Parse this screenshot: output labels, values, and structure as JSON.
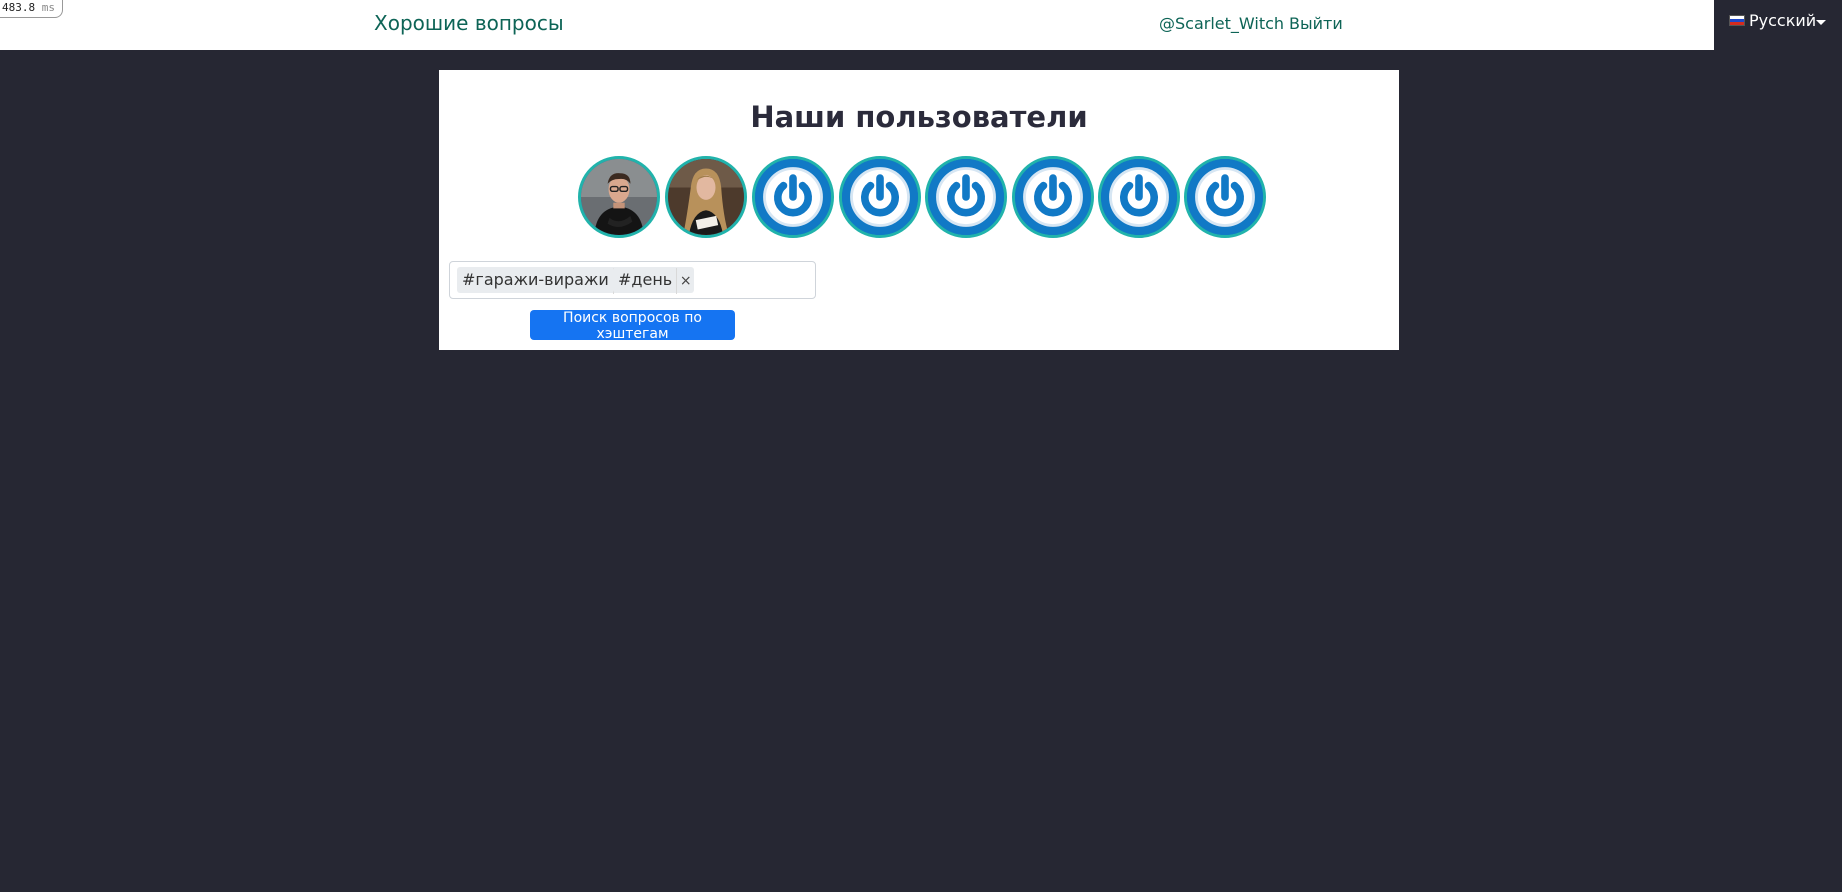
{
  "perf": {
    "value": "483.8",
    "unit": "ms"
  },
  "navbar": {
    "brand": "Хорошие вопросы",
    "user": "@Scarlet_Witch",
    "logout": "Выйти",
    "language": "Русский"
  },
  "main": {
    "title": "Наши пользователи",
    "avatars": [
      {
        "kind": "photo-man"
      },
      {
        "kind": "photo-woman"
      },
      {
        "kind": "default-power-icon"
      },
      {
        "kind": "default-power-icon"
      },
      {
        "kind": "default-power-icon"
      },
      {
        "kind": "default-power-icon"
      },
      {
        "kind": "default-power-icon"
      },
      {
        "kind": "default-power-icon"
      }
    ],
    "hashtags": [
      "#гаражи-виражи",
      "#день"
    ],
    "remove_symbol": "×",
    "search_button": "Поиск вопросов по хэштегам"
  },
  "colors": {
    "page_background": "#262733",
    "link": "#0d6456",
    "avatar_ring": "#21b3ab",
    "avatar_default": "#1179c6",
    "primary_button": "#1574f2"
  }
}
